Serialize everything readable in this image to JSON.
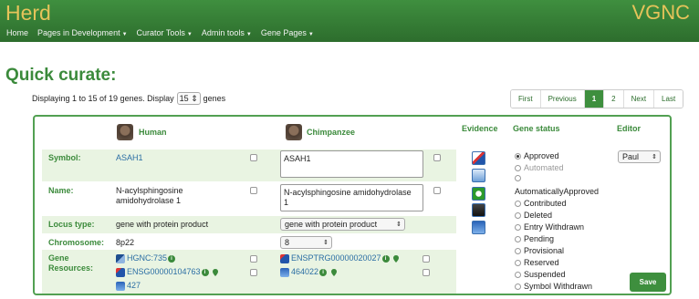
{
  "header": {
    "brand": "Herd",
    "brand_right": "VGNC",
    "nav": [
      "Home",
      "Pages in Development",
      "Curator Tools",
      "Admin tools",
      "Gene Pages"
    ]
  },
  "page": {
    "title": "Quick curate:",
    "display_prefix": "Displaying 1 to 15 of 19 genes. Display",
    "display_count": "15",
    "display_suffix": "genes"
  },
  "pager": [
    "First",
    "Previous",
    "1",
    "2",
    "Next",
    "Last"
  ],
  "columns": {
    "human": "Human",
    "chimp": "Chimpanzee",
    "evidence": "Evidence",
    "status": "Gene status",
    "editor": "Editor"
  },
  "rows": {
    "symbol": {
      "label": "Symbol:",
      "human": "ASAH1",
      "chimp": "ASAH1"
    },
    "name": {
      "label": "Name:",
      "human_line1": "N-acylsphingosine",
      "human_line2": "amidohydrolase 1",
      "chimp_line1": "N-acylsphingosine amidohydrolase",
      "chimp_line2": "1"
    },
    "locus": {
      "label": "Locus type:",
      "human": "gene with protein product",
      "chimp": "gene with protein product"
    },
    "chromosome": {
      "label": "Chromosome:",
      "human": "8p22",
      "chimp": "8"
    },
    "resources": {
      "label_line1": "Gene",
      "label_line2": "Resources:",
      "human": [
        "HGNC:735",
        "ENSG00000104763",
        "427"
      ],
      "chimp": [
        "ENSPTRG00000020027",
        "464022"
      ]
    }
  },
  "gene_status": {
    "options": [
      "Approved",
      "Automated",
      "AutomaticallyApproved",
      "Contributed",
      "Deleted",
      "Entry Withdrawn",
      "Pending",
      "Provisional",
      "Reserved",
      "Suspended",
      "Symbol Withdrawn"
    ],
    "selected": "Approved"
  },
  "editor": {
    "value": "Paul"
  },
  "save_label": "Save",
  "icons": {
    "evidence": [
      "ensembl-icon",
      "ncbi-icon",
      "green-ring-icon",
      "image-icon",
      "ncbi-icon"
    ]
  }
}
